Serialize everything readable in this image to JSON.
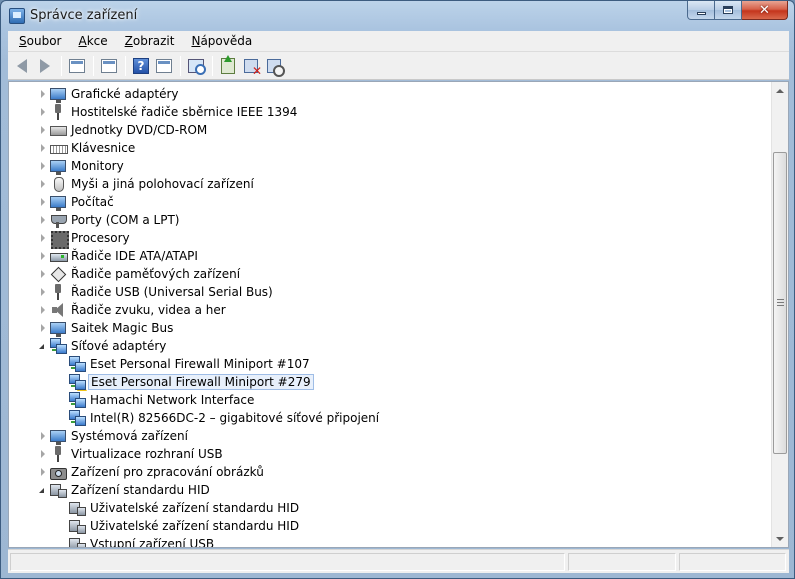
{
  "window": {
    "title": "Správce zařízení"
  },
  "menu": {
    "items": [
      {
        "key": "S",
        "rest": "oubor"
      },
      {
        "key": "A",
        "rest": "kce"
      },
      {
        "key": "Z",
        "rest": "obrazit"
      },
      {
        "key": "N",
        "rest": "ápověda"
      }
    ]
  },
  "toolbar": {
    "buttons": [
      "back",
      "forward",
      "show-hide-tree",
      "properties",
      "help",
      "device-view",
      "scan-hardware",
      "update-driver",
      "uninstall",
      "disable"
    ]
  },
  "tree": {
    "rows": [
      {
        "label": "Grafické adaptéry",
        "level": 0,
        "state": "collapsed",
        "icon": "display"
      },
      {
        "label": "Hostitelské řadiče sběrnice IEEE 1394",
        "level": 0,
        "state": "collapsed",
        "icon": "plug"
      },
      {
        "label": "Jednotky DVD/CD-ROM",
        "level": 0,
        "state": "collapsed",
        "icon": "disc"
      },
      {
        "label": "Klávesnice",
        "level": 0,
        "state": "collapsed",
        "icon": "keyboard"
      },
      {
        "label": "Monitory",
        "level": 0,
        "state": "collapsed",
        "icon": "display"
      },
      {
        "label": "Myši a jiná polohovací zařízení",
        "level": 0,
        "state": "collapsed",
        "icon": "mouse"
      },
      {
        "label": "Počítač",
        "level": 0,
        "state": "collapsed",
        "icon": "display"
      },
      {
        "label": "Porty (COM a LPT)",
        "level": 0,
        "state": "collapsed",
        "icon": "port"
      },
      {
        "label": "Procesory",
        "level": 0,
        "state": "collapsed",
        "icon": "cpu"
      },
      {
        "label": "Řadiče IDE ATA/ATAPI",
        "level": 0,
        "state": "collapsed",
        "icon": "ide"
      },
      {
        "label": "Řadiče paměťových zařízení",
        "level": 0,
        "state": "collapsed",
        "icon": "memory"
      },
      {
        "label": "Řadiče USB (Universal Serial Bus)",
        "level": 0,
        "state": "collapsed",
        "icon": "plug"
      },
      {
        "label": "Řadiče zvuku, videa a her",
        "level": 0,
        "state": "collapsed",
        "icon": "speaker"
      },
      {
        "label": "Saitek Magic Bus",
        "level": 0,
        "state": "collapsed",
        "icon": "display"
      },
      {
        "label": "Síťové adaptéry",
        "level": 0,
        "state": "expanded",
        "icon": "net"
      },
      {
        "label": "Eset Personal Firewall Miniport #107",
        "level": 1,
        "state": "leaf",
        "icon": "net"
      },
      {
        "label": "Eset Personal Firewall Miniport #279",
        "level": 1,
        "state": "leaf",
        "icon": "net",
        "warning": true,
        "selected": true
      },
      {
        "label": "Hamachi Network Interface",
        "level": 1,
        "state": "leaf",
        "icon": "net"
      },
      {
        "label": "Intel(R) 82566DC-2 – gigabitové síťové připojení",
        "level": 1,
        "state": "leaf",
        "icon": "net"
      },
      {
        "label": "Systémová zařízení",
        "level": 0,
        "state": "collapsed",
        "icon": "display"
      },
      {
        "label": "Virtualizace rozhraní USB",
        "level": 0,
        "state": "collapsed",
        "icon": "plug"
      },
      {
        "label": "Zařízení pro zpracování obrázků",
        "level": 0,
        "state": "collapsed",
        "icon": "camera"
      },
      {
        "label": "Zařízení standardu HID",
        "level": 0,
        "state": "expanded",
        "icon": "hid"
      },
      {
        "label": "Uživatelské zařízení standardu HID",
        "level": 1,
        "state": "leaf",
        "icon": "hid"
      },
      {
        "label": "Uživatelské zařízení standardu HID",
        "level": 1,
        "state": "leaf",
        "icon": "hid"
      },
      {
        "label": "Vstupní zařízení USB",
        "level": 1,
        "state": "leaf",
        "icon": "hid"
      }
    ]
  },
  "colors": {
    "selection_fill": "#e8f0fb",
    "selection_border": "#9fbde6",
    "warning": "#f0c419"
  }
}
